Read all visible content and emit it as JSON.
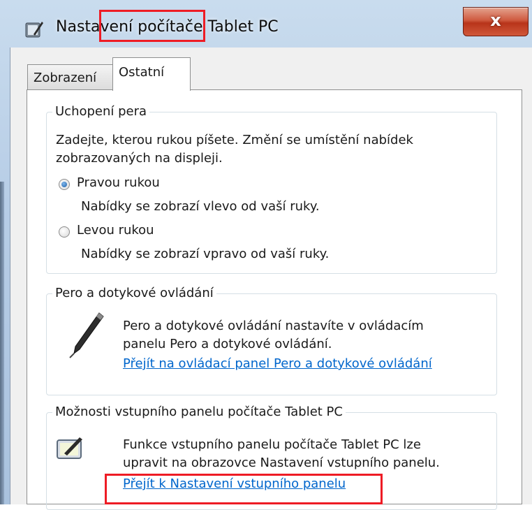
{
  "window": {
    "title": "Nastavení počítače Tablet PC",
    "close_label": "x"
  },
  "tabs": [
    {
      "label": "Zobrazení",
      "selected": false
    },
    {
      "label": "Ostatní",
      "selected": true
    }
  ],
  "handedness": {
    "title": "Uchopení pera",
    "description_line1": "Zadejte, kterou rukou píšete. Změní se umístění nabídek",
    "description_line2": "zobrazovaných na displeji.",
    "options": [
      {
        "label": "Pravou rukou",
        "hint": "Nabídky se zobrazí vlevo od vaší ruky.",
        "checked": true
      },
      {
        "label": "Levou rukou",
        "hint": "Nabídky se zobrazí vpravo od vaší ruky.",
        "checked": false
      }
    ]
  },
  "pen_touch": {
    "title": "Pero a dotykové ovládání",
    "text_line1": "Pero a dotykové ovládání nastavíte v ovládacím",
    "text_line2": "panelu Pero a dotykové ovládání.",
    "link": "Přejít na ovládací panel Pero a dotykové ovládání"
  },
  "input_panel": {
    "title": "Možnosti vstupního panelu počítače Tablet PC",
    "text_line1": "Funkce vstupního panelu počítače Tablet PC lze",
    "text_line2": "upravit na obrazovce Nastavení vstupního panelu.",
    "link": "Přejít k Nastavení vstupního panelu"
  },
  "colors": {
    "highlight": "#ee1c25",
    "link": "#0066cc",
    "close_button": "#c9452b"
  }
}
